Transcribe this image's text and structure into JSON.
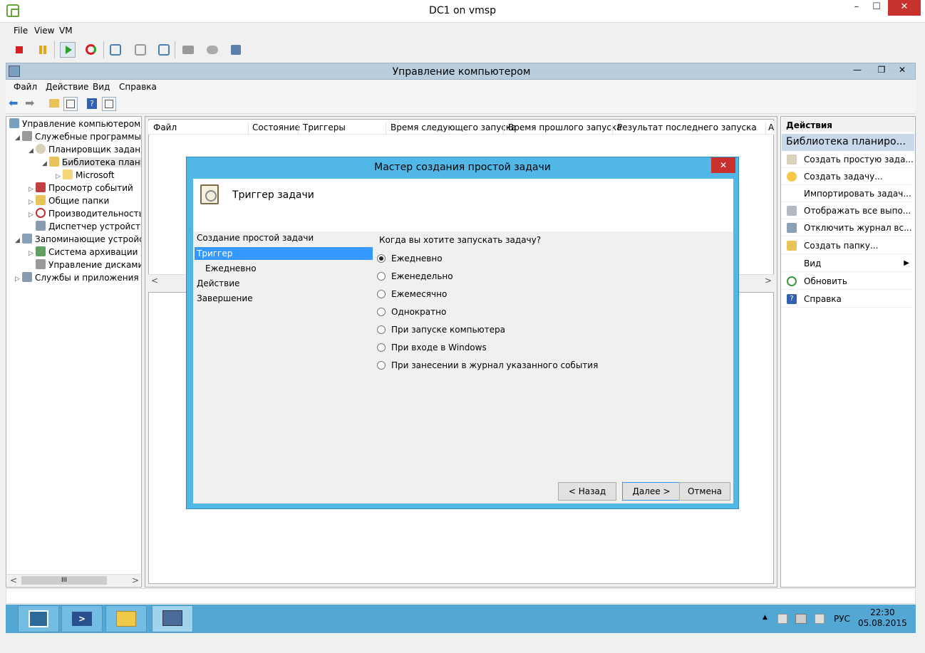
{
  "vm": {
    "title": "DC1 on vmsp",
    "menu": [
      "File",
      "View",
      "VM"
    ],
    "controls": {
      "minimize": "–",
      "maximize": "☐",
      "close": "✕"
    }
  },
  "mmc": {
    "title": "Управление компьютером",
    "menu": [
      "Файл",
      "Действие",
      "Вид",
      "Справка"
    ],
    "controls": {
      "minimize": "—",
      "restore": "❐",
      "close": "✕"
    }
  },
  "tree": [
    {
      "label": "Управление компьютером (л",
      "level": 0
    },
    {
      "label": "Служебные программы",
      "level": 1
    },
    {
      "label": "Планировщик заданий",
      "level": 2
    },
    {
      "label": "Библиотека планир",
      "level": 3
    },
    {
      "label": "Microsoft",
      "level": 4
    },
    {
      "label": "Просмотр событий",
      "level": 2
    },
    {
      "label": "Общие папки",
      "level": 2
    },
    {
      "label": "Производительность",
      "level": 2
    },
    {
      "label": "Диспетчер устройств",
      "level": 2
    },
    {
      "label": "Запоминающие устройст",
      "level": 1
    },
    {
      "label": "Система архивации да",
      "level": 2
    },
    {
      "label": "Управление дисками",
      "level": 2
    },
    {
      "label": "Службы и приложения",
      "level": 1
    }
  ],
  "list_columns": [
    "Файл",
    "Состояние",
    "Триггеры",
    "Время следующего запуска",
    "Время прошлого запуска",
    "Результат последнего запуска",
    "А"
  ],
  "actions": {
    "header": "Действия",
    "section": "Библиотека планиро...",
    "items": [
      "Создать простую зада...",
      "Создать задачу...",
      "Импортировать задач...",
      "Отображать все выпо...",
      "Отключить журнал вс...",
      "Создать папку...",
      "Вид",
      "Обновить",
      "Справка"
    ]
  },
  "dialog": {
    "title": "Мастер создания простой задачи",
    "close": "✕",
    "header": "Триггер задачи",
    "steps": [
      "Создание простой задачи",
      "Триггер",
      "Ежедневно",
      "Действие",
      "Завершение"
    ],
    "question": "Когда вы хотите запускать задачу?",
    "options": [
      "Ежедневно",
      "Еженедельно",
      "Ежемесячно",
      "Однократно",
      "При запуске компьютера",
      "При входе в Windows",
      "При занесении в журнал указанного события"
    ],
    "selected_option": "Ежедневно",
    "buttons": {
      "back": "< Назад",
      "next": "Далее >",
      "cancel": "Отмена"
    }
  },
  "scroll": {
    "left": "<",
    "right": ">",
    "thumb": "III"
  },
  "taskbar": {
    "language": "РУС",
    "time": "22:30",
    "date": "05.08.2015",
    "tray_arrow": "▲"
  },
  "colors": {
    "accent": "#51b7e7",
    "selection": "#3399ff",
    "close_red": "#c7322e",
    "taskbar": "#53a7d5"
  }
}
